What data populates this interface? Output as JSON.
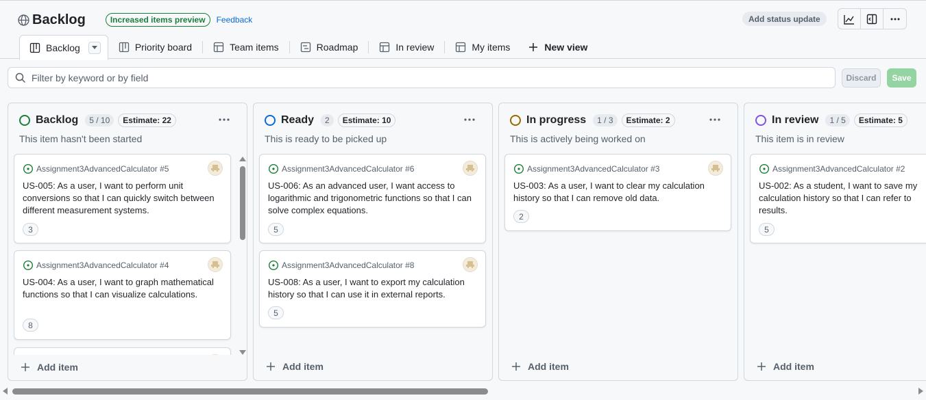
{
  "header": {
    "title": "Backlog",
    "preview_badge": "Increased items preview",
    "feedback": "Feedback",
    "status_update": "Add status update"
  },
  "tabs": [
    {
      "label": "Backlog",
      "icon": "board-icon"
    },
    {
      "label": "Priority board",
      "icon": "board-icon"
    },
    {
      "label": "Team items",
      "icon": "table-icon"
    },
    {
      "label": "Roadmap",
      "icon": "roadmap-icon"
    },
    {
      "label": "In review",
      "icon": "table-icon"
    },
    {
      "label": "My items",
      "icon": "table-icon"
    },
    {
      "label": "New view",
      "icon": "plus-icon"
    }
  ],
  "filter": {
    "placeholder": "Filter by keyword or by field",
    "discard": "Discard",
    "save": "Save"
  },
  "columns": [
    {
      "name": "Backlog",
      "count": "5 / 10",
      "estimate": "Estimate: 22",
      "description": "This item hasn't been started",
      "color": "#1a7f37",
      "add_item": "Add item",
      "cards": [
        {
          "ref": "Assignment3AdvancedCalculator #5",
          "title": "US-005: As a user, I want to perform unit conversions so that I can quickly switch between different measurement systems.",
          "estimate": "3"
        },
        {
          "ref": "Assignment3AdvancedCalculator #4",
          "title": "US-004: As a user, I want to graph mathematical functions so that I can visualize calculations.",
          "estimate": "8"
        }
      ]
    },
    {
      "name": "Ready",
      "count": "2",
      "estimate": "Estimate: 10",
      "description": "This is ready to be picked up",
      "color": "#0969da",
      "add_item": "Add item",
      "cards": [
        {
          "ref": "Assignment3AdvancedCalculator #6",
          "title": "US-006: As an advanced user, I want access to logarithmic and trigonometric functions so that I can solve complex equations.",
          "estimate": "5"
        },
        {
          "ref": "Assignment3AdvancedCalculator #8",
          "title": "US-008: As a user, I want to export my calculation history so that I can use it in external reports.",
          "estimate": "5"
        }
      ]
    },
    {
      "name": "In progress",
      "count": "1 / 3",
      "estimate": "Estimate: 2",
      "description": "This is actively being worked on",
      "color": "#9a6700",
      "add_item": "Add item",
      "cards": [
        {
          "ref": "Assignment3AdvancedCalculator #3",
          "title": "US-003: As a user, I want to clear my calculation history so that I can remove old data.",
          "estimate": "2"
        }
      ]
    },
    {
      "name": "In review",
      "count": "1 / 5",
      "estimate": "Estimate: 5",
      "description": "This item is in review",
      "color": "#8250df",
      "add_item": "Add item",
      "cards": [
        {
          "ref": "Assignment3AdvancedCalculator #2",
          "title": "US-002: As a student, I want to save my calculation history so that I can refer to results.",
          "estimate": "5"
        }
      ]
    }
  ]
}
